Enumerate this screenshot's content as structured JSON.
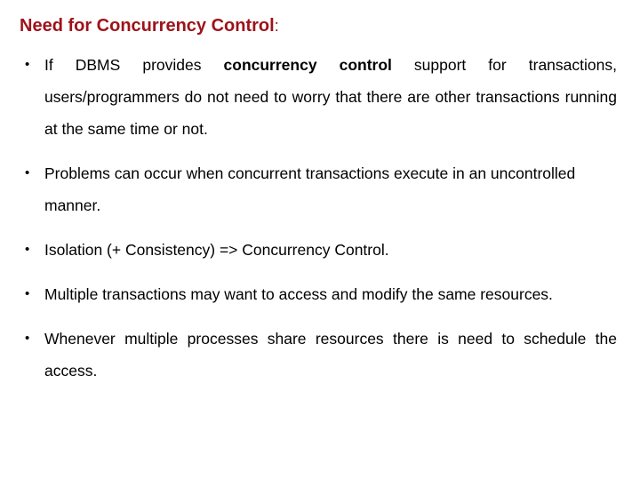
{
  "slide": {
    "title": "Need for Concurrency Control",
    "title_suffix": ":",
    "title_color": "#9E1219",
    "background_color": "#FFFFFF",
    "text_color": "#000000",
    "bullet_marker": "•",
    "bullets": [
      {
        "id": "bullet-dbms-concurrency-control-support",
        "marker": "•",
        "align": "justify",
        "segments": [
          {
            "text": "If DBMS provides ",
            "bold": false
          },
          {
            "text": "concurrency control",
            "bold": true
          },
          {
            "text": " support for transactions, users/programmers do not need to worry that there are other transactions running at the same time or not.",
            "bold": false
          }
        ],
        "plain_text": "If DBMS provides concurrency control support for transactions, users/programmers do not need to worry that there are other transactions running at the same time or not."
      },
      {
        "id": "bullet-problems-uncontrolled-manner",
        "marker": "•",
        "align": "left",
        "segments": [
          {
            "text": "Problems can occur when concurrent transactions execute in an uncontrolled manner.",
            "bold": false
          }
        ],
        "plain_text": "Problems can occur when concurrent transactions execute in an uncontrolled manner."
      },
      {
        "id": "bullet-isolation-consistency",
        "marker": "•",
        "align": "left",
        "segments": [
          {
            "text": "Isolation (+ Consistency) => Concurrency Control.",
            "bold": false
          }
        ],
        "plain_text": "Isolation (+ Consistency) => Concurrency Control."
      },
      {
        "id": "bullet-multiple-transactions-same-resources",
        "marker": "•",
        "align": "justify",
        "segments": [
          {
            "text": "Multiple transactions may want to access and modify the same resources.",
            "bold": false
          }
        ],
        "plain_text": "Multiple transactions may want to access and modify the same resources."
      },
      {
        "id": "bullet-schedule-access",
        "marker": "•",
        "align": "justify",
        "segments": [
          {
            "text": "Whenever multiple processes share resources there is need to schedule the access.",
            "bold": false
          }
        ],
        "plain_text": "Whenever multiple processes share resources there is need to schedule the access."
      }
    ]
  }
}
